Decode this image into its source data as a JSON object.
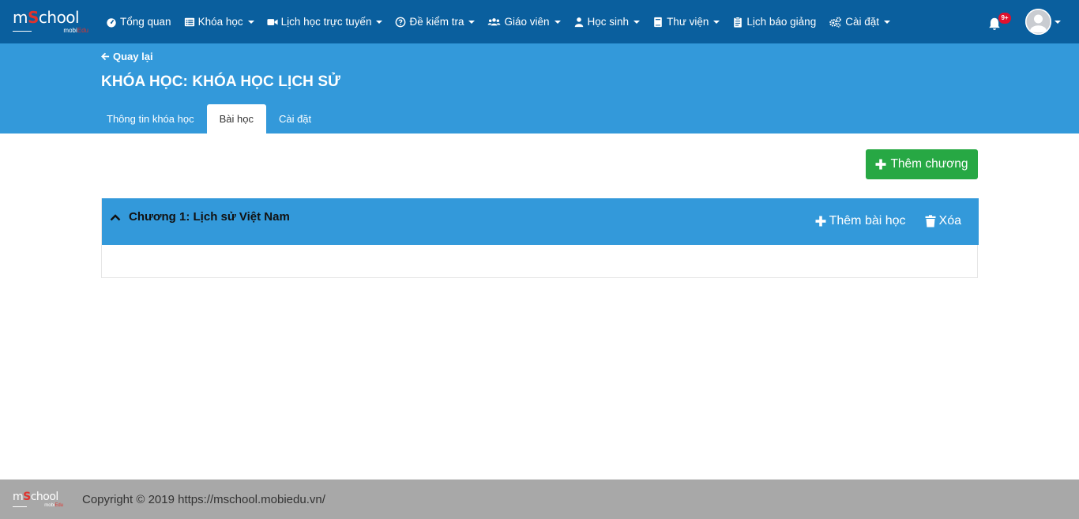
{
  "brand": {
    "logo_main_a": "m",
    "logo_main_s": "S",
    "logo_main_b": "chool",
    "logo_sub_a": "mobi",
    "logo_sub_b": "Edu"
  },
  "nav": {
    "items": [
      {
        "label": "Tổng quan",
        "icon": "dashboard-icon",
        "caret": false
      },
      {
        "label": "Khóa học",
        "icon": "list-icon",
        "caret": true
      },
      {
        "label": "Lịch học trực tuyến",
        "icon": "video-icon",
        "caret": true
      },
      {
        "label": "Đề kiểm tra",
        "icon": "question-icon",
        "caret": true
      },
      {
        "label": "Giáo viên",
        "icon": "users-icon",
        "caret": true
      },
      {
        "label": "Học sinh",
        "icon": "user-icon",
        "caret": true
      },
      {
        "label": "Thư viện",
        "icon": "book-icon",
        "caret": true
      },
      {
        "label": "Lịch báo giảng",
        "icon": "clipboard-icon",
        "caret": false
      },
      {
        "label": "Cài đặt",
        "icon": "gears-icon",
        "caret": true
      }
    ],
    "notifications_badge": "9+"
  },
  "header": {
    "back_label": "Quay lại",
    "course_title": "KHÓA HỌC: KHÓA HỌC LỊCH SỬ",
    "tabs": [
      {
        "label": "Thông tin khóa học",
        "active": false
      },
      {
        "label": "Bài học",
        "active": true
      },
      {
        "label": "Cài đặt",
        "active": false
      }
    ]
  },
  "content": {
    "add_chapter_label": "Thêm chương",
    "chapters": [
      {
        "title": "Chương 1: Lịch sử Việt Nam",
        "add_lesson_label": "Thêm bài học",
        "delete_label": "Xóa"
      }
    ]
  },
  "footer": {
    "copyright": "Copyright © 2019 https://mschool.mobiedu.vn/"
  },
  "colors": {
    "navbar": "#0a5f9e",
    "header": "#3399da",
    "success": "#27a844",
    "footer": "#a8a8a8",
    "badge": "#e0102d"
  }
}
